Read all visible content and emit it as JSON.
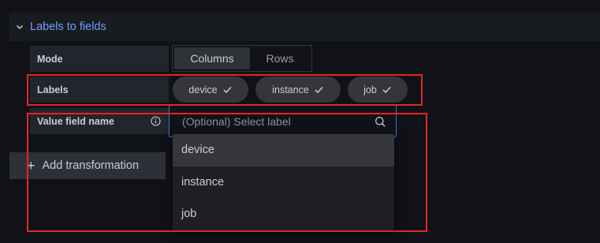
{
  "header": {
    "title": "Labels to fields"
  },
  "mode": {
    "label": "Mode",
    "options": [
      "Columns",
      "Rows"
    ],
    "selected": "Columns"
  },
  "labels": {
    "label": "Labels",
    "chips": [
      "device",
      "instance",
      "job"
    ]
  },
  "value_field": {
    "label": "Value field name",
    "placeholder": "(Optional) Select label"
  },
  "dropdown": {
    "options": [
      "device",
      "instance",
      "job"
    ]
  },
  "add_button": {
    "label": "Add transformation"
  },
  "colors": {
    "accent": "#6e9fff",
    "focus_border": "#3d71d9",
    "annotation_red": "#e02727"
  }
}
